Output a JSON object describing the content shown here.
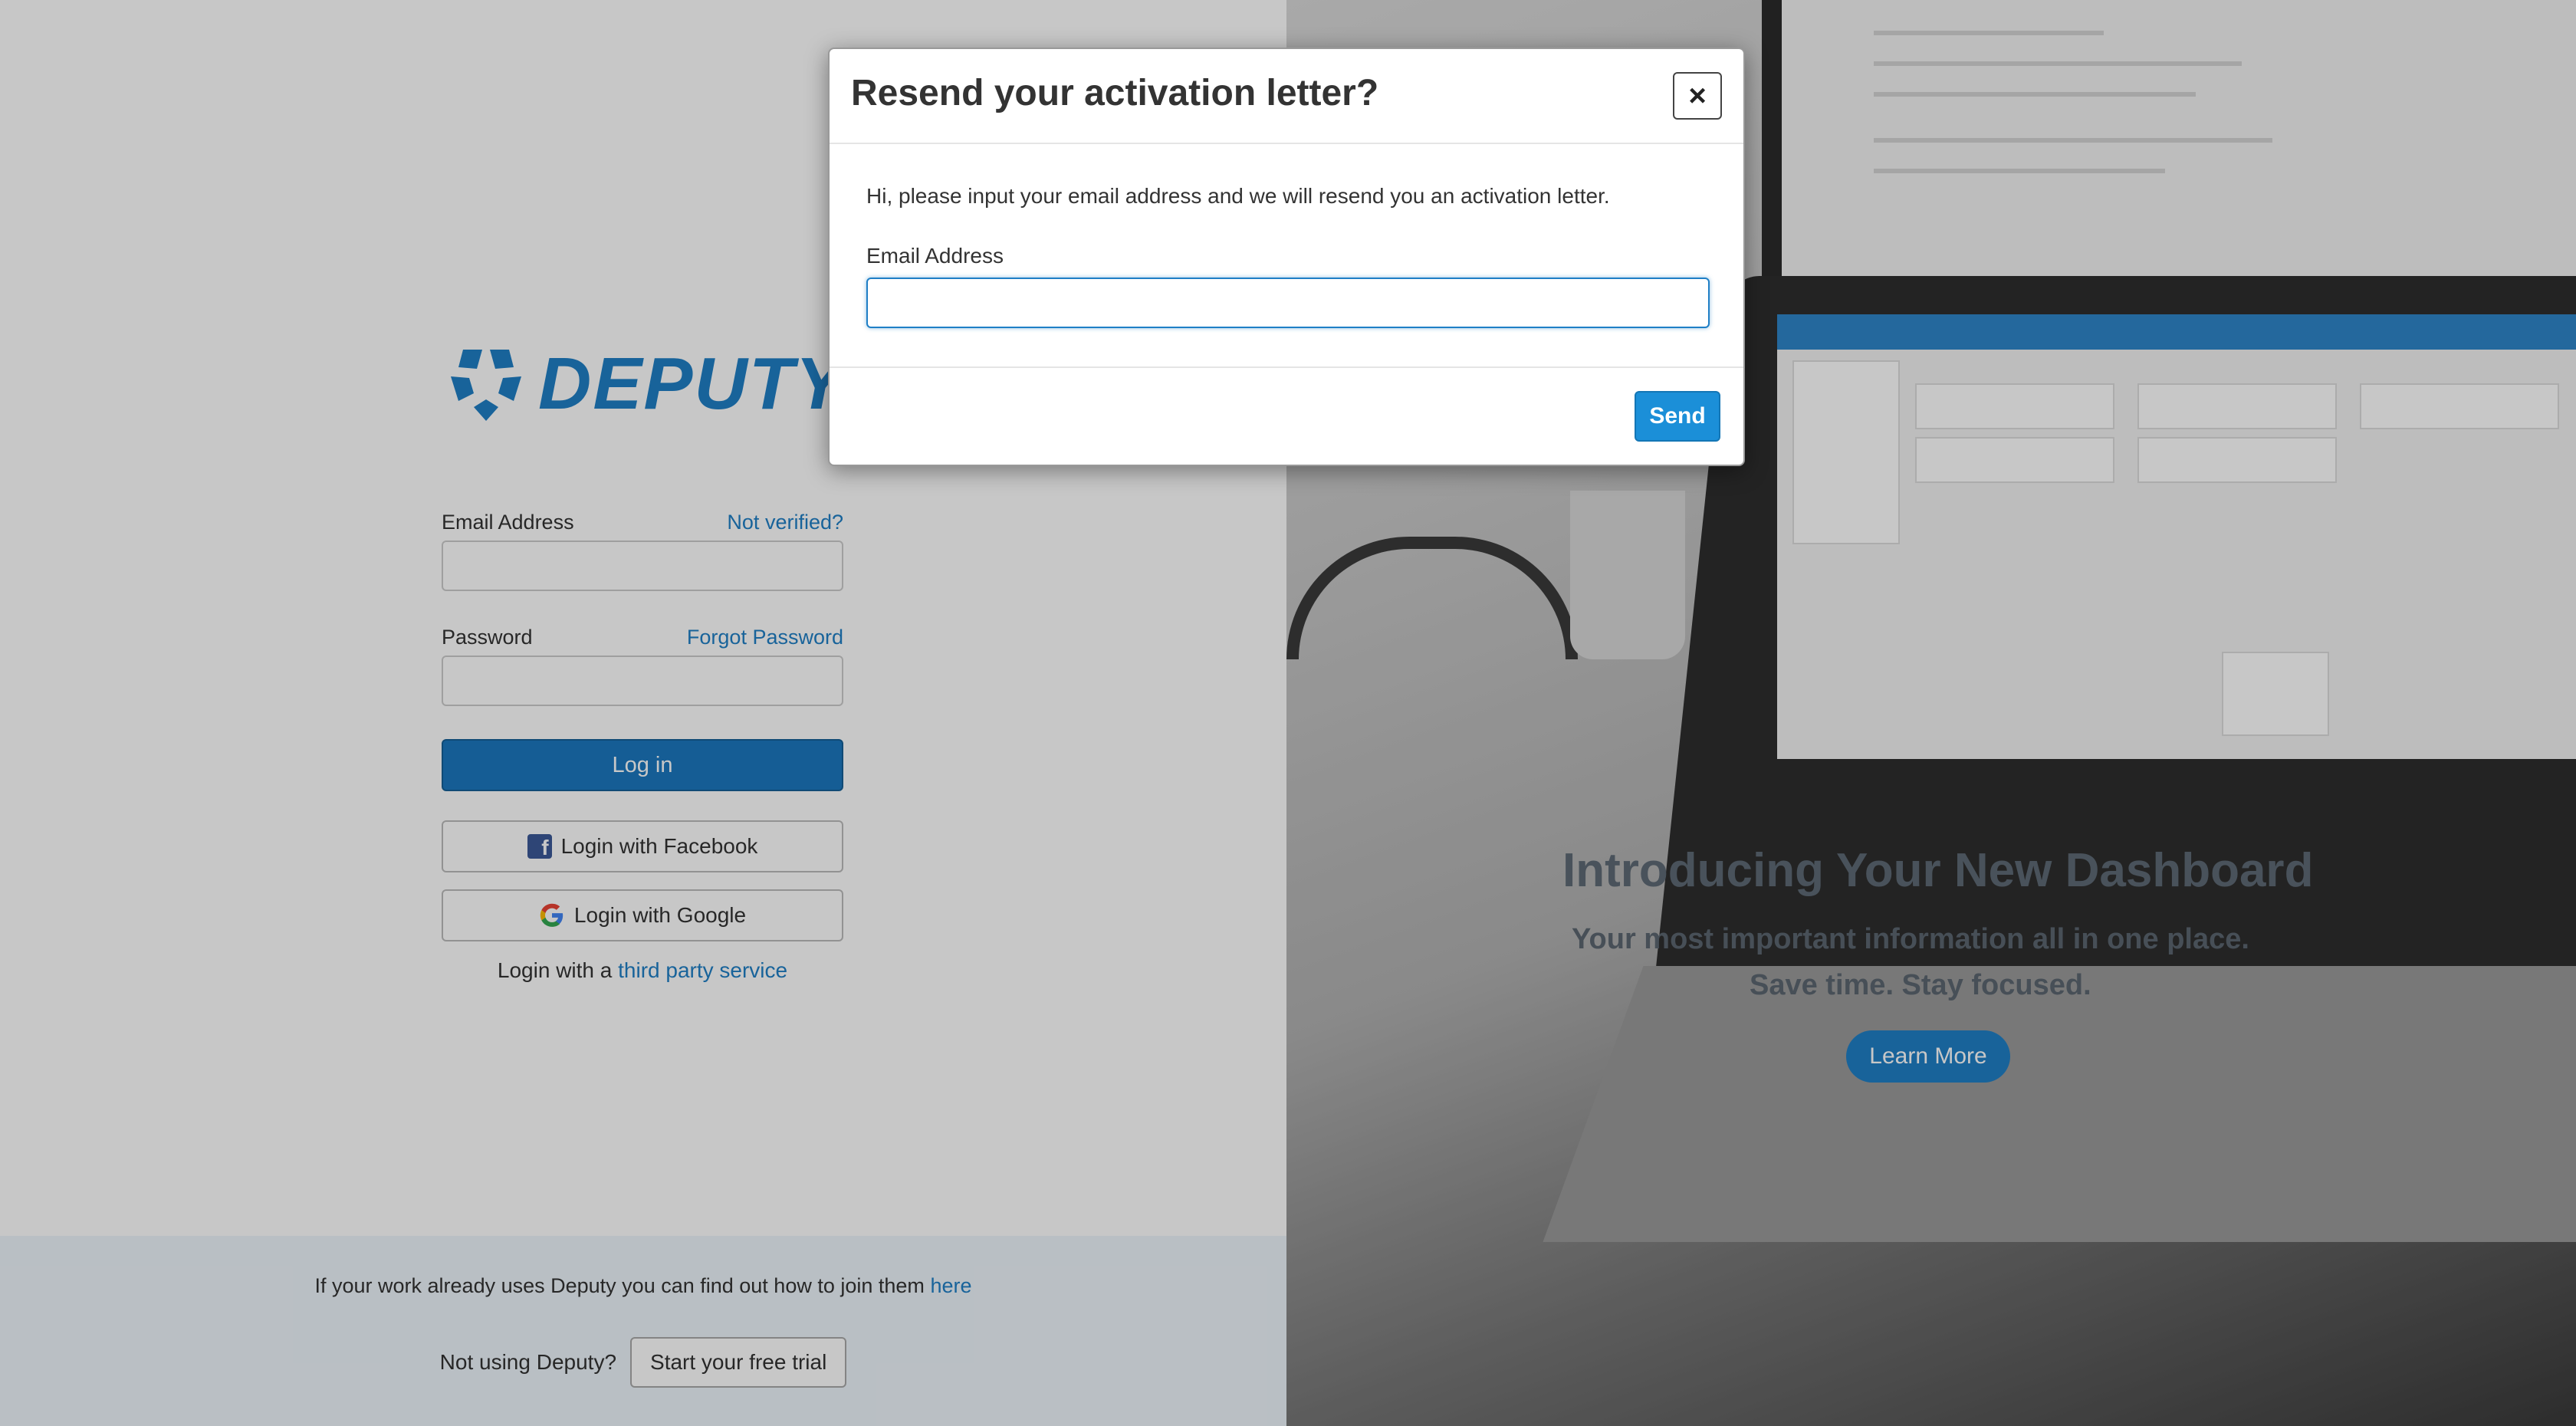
{
  "brand": {
    "logo_text": "DEPUTY"
  },
  "login": {
    "email_label": "Email Address",
    "not_verified_link": "Not verified?",
    "password_label": "Password",
    "forgot_password_link": "Forgot Password",
    "login_button": "Log in",
    "facebook_button": "Login with Facebook",
    "google_button": "Login with Google",
    "third_party_prefix": "Login with a",
    "third_party_link": "third party service"
  },
  "footer": {
    "join_text": "If your work already uses Deputy you can find out how to join them",
    "join_link": "here",
    "not_using": "Not using Deputy?",
    "trial_button": "Start your free trial"
  },
  "promo": {
    "title": "Introducing Your New Dashboard",
    "line1": "Your most important information all in one place.",
    "line2": "Save time. Stay focused.",
    "button": "Learn More"
  },
  "modal": {
    "title": "Resend your activation letter?",
    "close_symbol": "×",
    "description": "Hi, please input your email address and we will resend you an activation letter.",
    "email_label": "Email Address",
    "email_value": "",
    "send_button": "Send"
  },
  "colors": {
    "brand_blue": "#1f7fc6",
    "login_button": "#1b78bf",
    "send_button": "#1b8fd8",
    "facebook_blue": "#3b5998"
  }
}
